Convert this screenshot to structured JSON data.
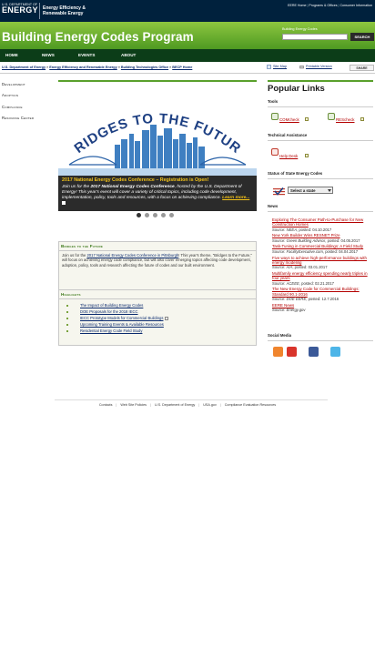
{
  "top": {
    "doe_small": "U.S. DEPARTMENT OF",
    "doe_big": "ENERGY",
    "office_line1": "Energy Efficiency &",
    "office_line2": "Renewable Energy",
    "links": [
      "EERE Home",
      "Programs & Offices",
      "Consumer Information"
    ]
  },
  "header": {
    "title": "Building Energy Codes Program",
    "search_label": "Building Energy Codes",
    "search_value": "",
    "search_button": "SEARCH"
  },
  "nav": [
    "HOME",
    "NEWS",
    "EVENTS",
    "ABOUT"
  ],
  "breadcrumb": [
    "U.S. Department of Energy",
    "Energy Efficiency and Renewable Energy",
    "Building Technologies Office",
    "BECP Home"
  ],
  "page_tools": {
    "sitemap": "Site Map",
    "printable": "Printable Version",
    "share": "SHARE"
  },
  "left_nav": [
    "Development",
    "Adoption",
    "Compliance",
    "Resource Center"
  ],
  "hero": {
    "graphic_text": "BRIDGES TO THE FUTURE",
    "title": "2017 National Energy Codes Conference – Registration is Open!",
    "text_pre": "Join us for the ",
    "text_bold": "2017 National Energy Codes Conference",
    "text_post": ", hosted by the U.S. Department of Energy! This year's event will cover a variety of critical topics, including code development, implementation, policy, tools and resources, with a focus on achieving compliance.",
    "more": "Learn more...",
    "slides": 5,
    "active_slide": 1
  },
  "bridges": {
    "heading": "Bridges to the Future",
    "text_pre": "Join us for the ",
    "link": "2017 National Energy Codes Conference in Pittsburgh",
    "text_post": "! This year's theme, \"Bridges to the Future,\" will focus on achieving energy code compliance, but will also cover emerging topics affecting code development, adoption, policy, tools and research affecting the future of codes and our built environment."
  },
  "highlights": {
    "heading": "Highlights",
    "items": [
      {
        "label": "The Impact of Building Energy Codes",
        "external": false
      },
      {
        "label": "DOE Proposals for the 2018 IECC",
        "external": false
      },
      {
        "label": "IECC Prototype Models for Commercial Buildings",
        "external": true
      },
      {
        "label": "Upcoming Training Events & Available Resources",
        "external": false
      },
      {
        "label": "Residential Energy Code Field Study",
        "external": false
      }
    ]
  },
  "sidebar": {
    "title": "Popular Links",
    "tools_heading": "Tools",
    "tools": [
      "COMcheck",
      "REScheck"
    ],
    "ta_heading": "Technical Assistance",
    "helpdesk": "Help Desk",
    "status_heading": "Status of State Energy Codes",
    "state_select": "Select a state",
    "news_heading": "News",
    "news": [
      {
        "title": "Exploring The Consumer Path-to-Purchase for New Construction Homes",
        "ext": true,
        "source": "Source: ",
        "src": "NEEA",
        "posted": ", posted: 04.10.2017"
      },
      {
        "title": "New York Builder Wins RESNET Prize",
        "ext": true,
        "source": "Source: ",
        "src": "Green Building Advisor",
        "posted": ", posted: 04.05.2017"
      },
      {
        "title": "Task-Tuning in Commercial Buildings: A Field Study",
        "ext": false,
        "source": "Source: ",
        "src": "FacilityExecutive.com",
        "posted": ", posted: 04.04.2017"
      },
      {
        "title": "Five ways to achieve high-performance buildings with energy modeling",
        "ext": true,
        "source": "Source: ",
        "src": "AIA",
        "posted": ", posted: 03.01.2017"
      },
      {
        "title": "Multifamily energy efficiency spending nearly triples in four years",
        "ext": true,
        "source": "Source: ",
        "src": "ACEEE",
        "posted": ", posted: 02.21.2017"
      },
      {
        "title": "The New Energy Code for Commercial Buildings: Standard 90.1-2016",
        "ext": true,
        "source": "Source: ",
        "src": "DOE EERE",
        "posted": ", posted: 12.7.2016"
      },
      {
        "title": "EERE News",
        "ext": true,
        "source": "Source: ",
        "src": "Energy.gov",
        "posted": ""
      }
    ],
    "social_heading": "Social Media",
    "social": [
      "rss-icon",
      "youtube-icon",
      "facebook-icon",
      "twitter-icon"
    ]
  },
  "footer": [
    "Contacts",
    "Web Site Policies",
    "U.S. Department of Energy",
    "USA.gov",
    "Compliance Evaluation Resources"
  ],
  "colors": {
    "navy": "#00213d",
    "green": "#5aa02c",
    "dark_green": "#0c3d18",
    "link_red": "#b40000",
    "gold": "#f3c218"
  }
}
